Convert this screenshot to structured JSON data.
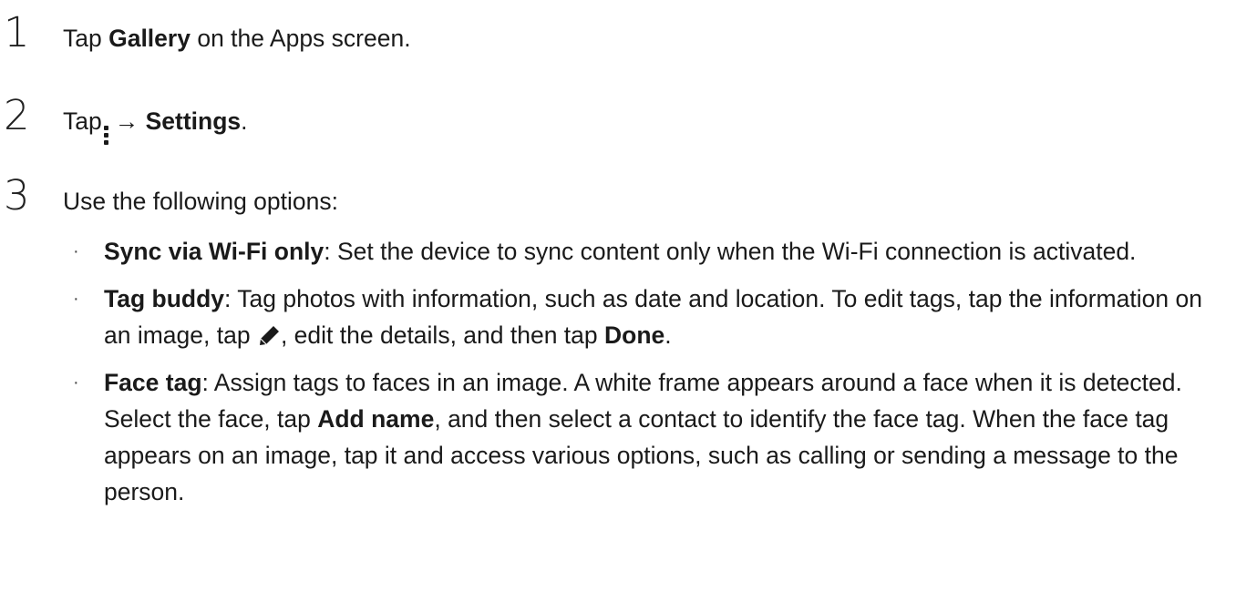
{
  "steps": [
    {
      "number": "1",
      "pre": "Tap ",
      "bold": "Gallery",
      "post": " on the Apps screen."
    },
    {
      "number": "2",
      "pre": "Tap",
      "arrow": "→",
      "bold": "Settings",
      "post": ".",
      "icon": "more-options-icon"
    },
    {
      "number": "3",
      "text": "Use the following options:"
    }
  ],
  "options": [
    {
      "bullet": "·",
      "title": "Sync via Wi-Fi only",
      "body": ": Set the device to sync content only when the Wi-Fi connection is activated."
    },
    {
      "bullet": "·",
      "title": "Tag buddy",
      "body_before_icon": ": Tag photos with information, such as date and location. To edit tags, tap the information on an image, tap ",
      "icon": "pencil-icon",
      "body_after_icon": ", edit the details, and then tap ",
      "bold_end": "Done",
      "end": "."
    },
    {
      "bullet": "·",
      "title": "Face tag",
      "body_before_bold": ": Assign tags to faces in an image. A white frame appears around a face when it is detected. Select the face, tap ",
      "bold_mid": "Add name",
      "body_after_bold": ", and then select a contact to identify the face tag. When the face tag appears on an image, tap it and access various options, such as calling or sending a message to the person."
    }
  ]
}
